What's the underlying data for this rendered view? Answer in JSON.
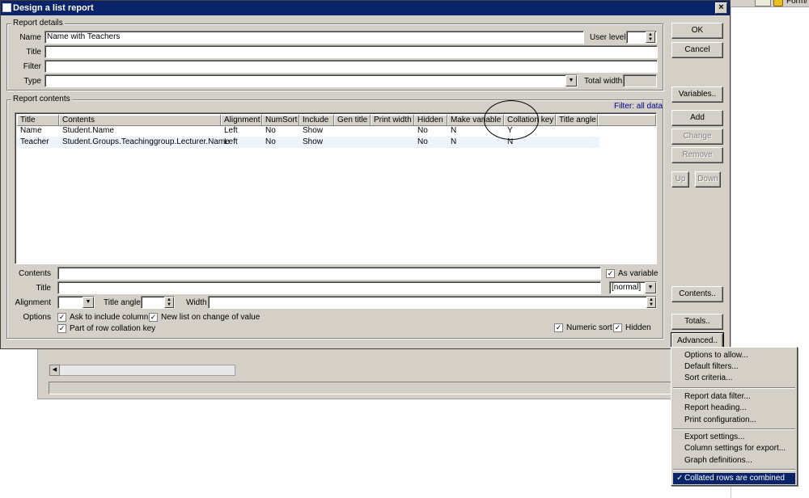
{
  "background_app": {
    "window_text": "Form/"
  },
  "dialog": {
    "title": "Design a list report",
    "close_glyph": "×"
  },
  "report_details": {
    "group_label": "Report details",
    "name_label": "Name",
    "name_value": "Name with Teachers",
    "user_level_label": "User level",
    "user_level_value": "",
    "title_label": "Title",
    "title_value": "",
    "filter_label": "Filter",
    "filter_value": "",
    "type_label": "Type",
    "type_value": "",
    "total_width_label": "Total width",
    "total_width_value": ""
  },
  "report_contents": {
    "group_label": "Report contents",
    "filter_status": "Filter: all data",
    "columns": [
      "Title",
      "Contents",
      "Alignment",
      "NumSort",
      "Include",
      "Gen title",
      "Print width",
      "Hidden",
      "Make variable",
      "Collation key",
      "Title angle"
    ],
    "rows": [
      {
        "title": "Name",
        "contents": "Student.Name",
        "alignment": "Left",
        "numsort": "No",
        "include": "Show",
        "gen_title": "",
        "print_width": "",
        "hidden": "No",
        "make_variable": "N",
        "collation_key": "Y",
        "title_angle": ""
      },
      {
        "title": "Teacher",
        "contents": "Student.Groups.Teachinggroup.Lecturer.Name",
        "alignment": "Left",
        "numsort": "No",
        "include": "Show",
        "gen_title": "",
        "print_width": "",
        "hidden": "No",
        "make_variable": "N",
        "collation_key": "N",
        "title_angle": ""
      }
    ]
  },
  "column_editor": {
    "contents_label": "Contents",
    "contents_value": "",
    "as_variable_label": "As variable",
    "as_variable_checked": true,
    "title_label": "Title",
    "title_value": "",
    "title_style_value": "[normal]",
    "alignment_label": "Alignment",
    "alignment_value": "",
    "title_angle_label": "Title angle",
    "title_angle_value": "",
    "width_label": "Width",
    "width_value": "",
    "options_label": "Options",
    "ask_include_label": "Ask to  include column",
    "ask_include_checked": true,
    "new_list_label": "New list on change of value",
    "new_list_checked": true,
    "row_collation_label": "Part of row collation key",
    "row_collation_checked": true,
    "numeric_sort_label": "Numeric sort",
    "numeric_sort_checked": true,
    "hidden_label": "Hidden",
    "hidden_checked": true,
    "check_glyph": "✓"
  },
  "buttons": {
    "ok": "OK",
    "cancel": "Cancel",
    "variables": "Variables..",
    "add": "Add",
    "change": "Change",
    "remove": "Remove",
    "up": "Up",
    "down": "Down",
    "contents": "Contents..",
    "totals": "Totals..",
    "advanced": "Advanced.."
  },
  "advanced_menu": {
    "items": [
      "Options to allow...",
      "Default filters...",
      "Sort criteria...",
      "Report data filter...",
      "Report heading...",
      "Print configuration...",
      "Export settings...",
      "Column settings for export...",
      "Graph definitions...",
      "Collated rows are combined"
    ],
    "checked_item": "Collated rows are combined",
    "check_glyph": "✓"
  }
}
